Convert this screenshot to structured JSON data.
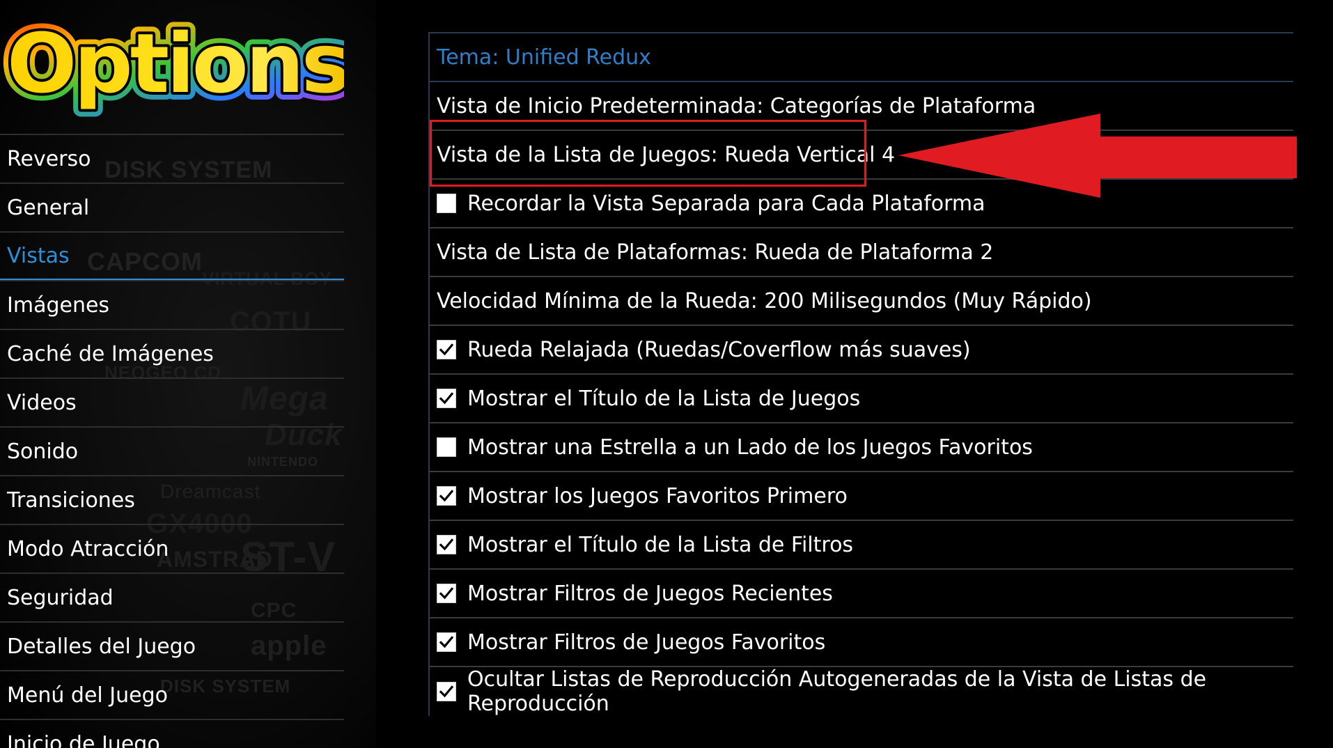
{
  "app": {
    "logo_text": "Options",
    "accent_color": "#2f8fd8",
    "highlight_color": "#e11b22"
  },
  "sidebar": {
    "items": [
      {
        "label": "Reverso",
        "active": false
      },
      {
        "label": "General",
        "active": false
      },
      {
        "label": "Vistas",
        "active": true
      },
      {
        "label": "Imágenes",
        "active": false
      },
      {
        "label": "Caché de Imágenes",
        "active": false
      },
      {
        "label": "Videos",
        "active": false
      },
      {
        "label": "Sonido",
        "active": false
      },
      {
        "label": "Transiciones",
        "active": false
      },
      {
        "label": "Modo Atracción",
        "active": false
      },
      {
        "label": "Seguridad",
        "active": false
      },
      {
        "label": "Detalles del Juego",
        "active": false
      },
      {
        "label": "Menú del Juego",
        "active": false
      },
      {
        "label": "Inicio de Juego",
        "active": false
      }
    ]
  },
  "options": {
    "header": "Tema: Unified Redux",
    "rows": [
      {
        "label": "Vista de Inicio Predeterminada: Categorías de Plataforma",
        "checkbox": null
      },
      {
        "label": "Vista de la Lista de Juegos: Rueda Vertical 4",
        "checkbox": null,
        "highlighted": true
      },
      {
        "label": "Recordar la Vista Separada para Cada Plataforma",
        "checkbox": false
      },
      {
        "label": "Vista de Lista de Plataformas: Rueda de Plataforma 2",
        "checkbox": null
      },
      {
        "label": "Velocidad Mínima de la Rueda: 200 Milisegundos (Muy Rápido)",
        "checkbox": null
      },
      {
        "label": "Rueda Relajada (Ruedas/Coverflow más suaves)",
        "checkbox": true
      },
      {
        "label": "Mostrar el Título de la Lista de Juegos",
        "checkbox": true
      },
      {
        "label": "Mostrar una Estrella a un Lado de los Juegos Favoritos",
        "checkbox": false
      },
      {
        "label": "Mostrar los Juegos Favoritos Primero",
        "checkbox": true
      },
      {
        "label": "Mostrar el Título de la Lista de Filtros",
        "checkbox": true
      },
      {
        "label": "Mostrar Filtros de Juegos Recientes",
        "checkbox": true
      },
      {
        "label": "Mostrar Filtros de Juegos Favoritos",
        "checkbox": true
      },
      {
        "label": "Ocultar Listas de Reproducción Autogeneradas de la Vista de Listas de Reproducción",
        "checkbox": true
      }
    ]
  },
  "icons": {
    "checkmark": "checkmark-icon",
    "arrow": "left-arrow-icon"
  }
}
